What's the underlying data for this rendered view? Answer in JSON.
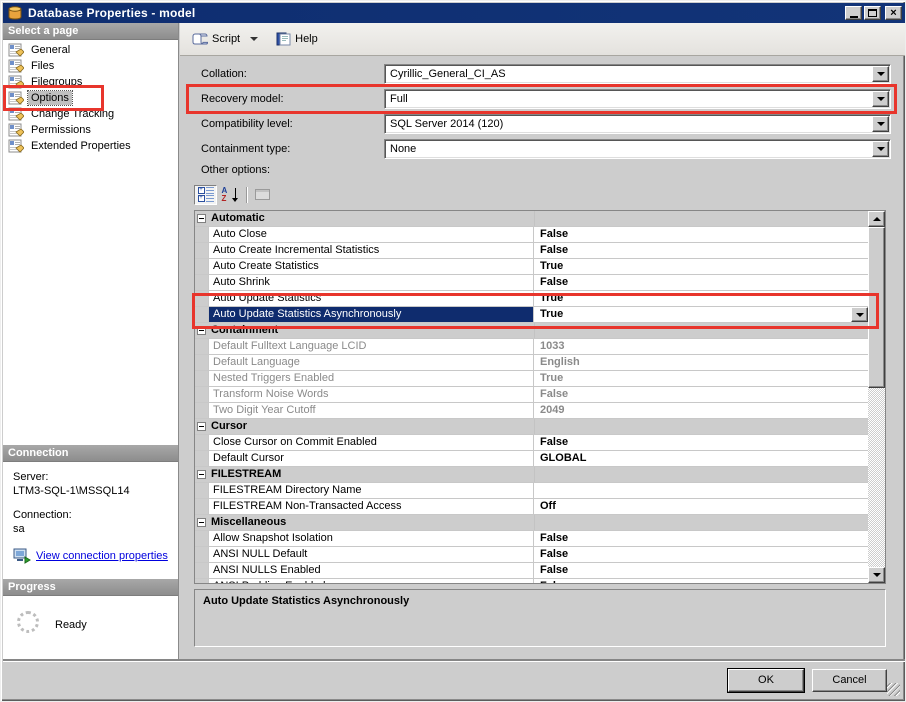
{
  "window": {
    "title": "Database Properties - model",
    "controls": {
      "minimize": "",
      "maximize": "",
      "close": "×"
    }
  },
  "sidebar": {
    "header": "Select a page",
    "items": [
      {
        "label": "General",
        "selected": false
      },
      {
        "label": "Files",
        "selected": false
      },
      {
        "label": "Filegroups",
        "selected": false
      },
      {
        "label": "Options",
        "selected": true
      },
      {
        "label": "Change Tracking",
        "selected": false
      },
      {
        "label": "Permissions",
        "selected": false
      },
      {
        "label": "Extended Properties",
        "selected": false
      }
    ],
    "connection": {
      "header": "Connection",
      "server_label": "Server:",
      "server_value": "LTM3-SQL-1\\MSSQL14",
      "connection_label": "Connection:",
      "connection_value": "sa",
      "link_label": "View connection properties"
    },
    "progress": {
      "header": "Progress",
      "status": "Ready"
    }
  },
  "toolbar": {
    "script": "Script",
    "help": "Help"
  },
  "options_page": {
    "fields": [
      {
        "label": "Collation:",
        "value": "Cyrillic_General_CI_AS"
      },
      {
        "label": "Recovery model:",
        "value": "Full"
      },
      {
        "label": "Compatibility level:",
        "value": "SQL Server 2014 (120)"
      },
      {
        "label": "Containment type:",
        "value": "None"
      }
    ],
    "other_options_label": "Other options:",
    "az_icon": {
      "a": "A",
      "z": "Z"
    }
  },
  "grid": {
    "sections": [
      {
        "name": "Automatic",
        "disabled": false,
        "rows": [
          {
            "label": "Auto Close",
            "value": "False"
          },
          {
            "label": "Auto Create Incremental Statistics",
            "value": "False"
          },
          {
            "label": "Auto Create Statistics",
            "value": "True"
          },
          {
            "label": "Auto Shrink",
            "value": "False"
          },
          {
            "label": "Auto Update Statistics",
            "value": "True"
          },
          {
            "label": "Auto Update Statistics Asynchronously",
            "value": "True",
            "selected": true
          }
        ]
      },
      {
        "name": "Containment",
        "disabled": true,
        "rows": [
          {
            "label": "Default Fulltext Language LCID",
            "value": "1033"
          },
          {
            "label": "Default Language",
            "value": "English"
          },
          {
            "label": "Nested Triggers Enabled",
            "value": "True"
          },
          {
            "label": "Transform Noise Words",
            "value": "False"
          },
          {
            "label": "Two Digit Year Cutoff",
            "value": "2049"
          }
        ]
      },
      {
        "name": "Cursor",
        "disabled": false,
        "rows": [
          {
            "label": "Close Cursor on Commit Enabled",
            "value": "False"
          },
          {
            "label": "Default Cursor",
            "value": "GLOBAL"
          }
        ]
      },
      {
        "name": "FILESTREAM",
        "disabled": false,
        "rows": [
          {
            "label": "FILESTREAM Directory Name",
            "value": ""
          },
          {
            "label": "FILESTREAM Non-Transacted Access",
            "value": "Off"
          }
        ]
      },
      {
        "name": "Miscellaneous",
        "disabled": false,
        "rows": [
          {
            "label": "Allow Snapshot Isolation",
            "value": "False"
          },
          {
            "label": "ANSI NULL Default",
            "value": "False"
          },
          {
            "label": "ANSI NULLS Enabled",
            "value": "False"
          },
          {
            "label": "ANSI Padding Enabled",
            "value": "False"
          }
        ]
      }
    ]
  },
  "description_panel": {
    "title": "Auto Update Statistics Asynchronously"
  },
  "footer": {
    "ok": "OK",
    "cancel": "Cancel"
  }
}
